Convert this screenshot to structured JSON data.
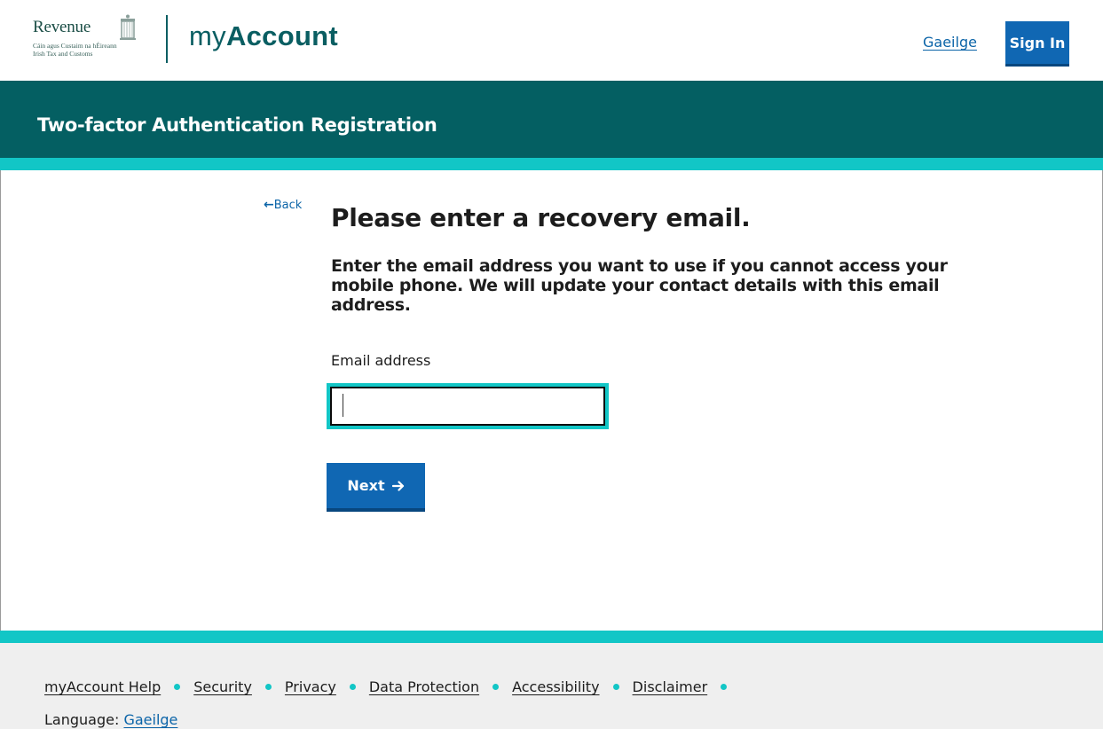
{
  "header": {
    "logo_name": "Revenue",
    "logo_sub1": "Cáin agus Custaim na hÉireann",
    "logo_sub2": "Irish Tax and Customs",
    "brand_my": "my",
    "brand_account": "Account",
    "language_link": "Gaeilge",
    "sign_in_label": "Sign In"
  },
  "banner": {
    "title": "Two-factor Authentication Registration"
  },
  "main": {
    "back_label": "Back",
    "title": "Please enter a recovery email.",
    "lead": "Enter the email address you want to use if you cannot access your mobile phone. We will update your contact details with this email address.",
    "email_label": "Email address",
    "email_value": "",
    "next_label": "Next"
  },
  "footer": {
    "links": [
      "myAccount Help",
      "Security",
      "Privacy",
      "Data Protection",
      "Accessibility",
      "Disclaimer"
    ],
    "language_prefix": "Language:",
    "language_link": "Gaeilge"
  },
  "colors": {
    "brand_teal": "#045f62",
    "accent_cyan": "#12c6c6",
    "button_blue": "#1067b3",
    "link_blue": "#0b64a8"
  },
  "icons": {
    "back": "arrow-left-icon",
    "next": "arrow-right-icon",
    "logo": "harp-icon"
  }
}
